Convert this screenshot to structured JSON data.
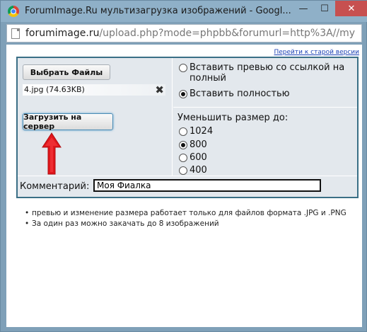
{
  "window": {
    "title": "ForumImage.Ru мультизагрузка изображений - Googl...",
    "minimize_label": "—",
    "maximize_label": "☐",
    "close_label": "✕"
  },
  "address": {
    "host": "forumimage.ru",
    "path": "/upload.php?mode=phpbb&forumurl=http%3A//my"
  },
  "page": {
    "old_version_link": "Перейти к старой версии",
    "choose_files_button": "Выбрать Файлы",
    "file": {
      "name": "4.jpg (74.63KB)",
      "remove_icon": "close-icon"
    },
    "upload_button": "Загрузить на сервер",
    "insert_options": [
      {
        "label": "Вставить превью со ссылкой на полный",
        "selected": false
      },
      {
        "label": "Вставить полностью",
        "selected": true
      }
    ],
    "resize_label": "Уменьшить размер до:",
    "resize_options": [
      {
        "label": "1024",
        "selected": false
      },
      {
        "label": "800",
        "selected": true
      },
      {
        "label": "600",
        "selected": false
      },
      {
        "label": "400",
        "selected": false
      }
    ],
    "comment_label": "Комментарий:",
    "comment_value": "Моя Фиалка",
    "notes": [
      "превью и изменение размера работает только для файлов формата .JPG и .PNG",
      "За один раз можно закачать до 8 изображений"
    ]
  },
  "colors": {
    "panel_border": "#3a6f86",
    "panel_bg": "#e3e8ed",
    "arrow": "#e0161b",
    "link": "#1a3fb5"
  }
}
